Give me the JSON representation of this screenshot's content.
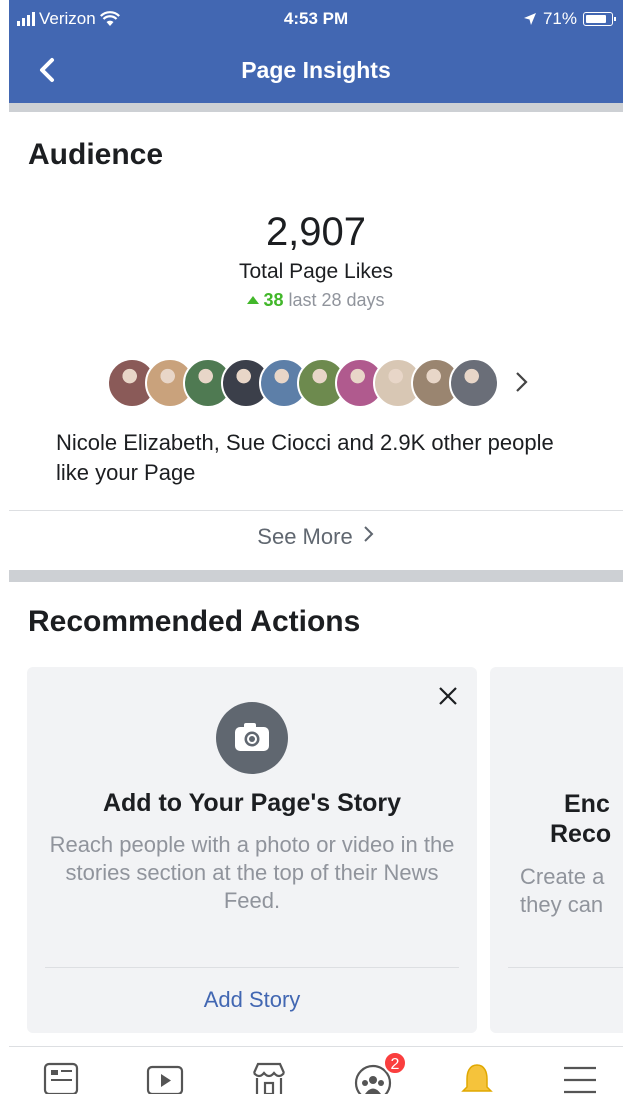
{
  "status_bar": {
    "carrier": "Verizon",
    "time": "4:53 PM",
    "battery": "71%"
  },
  "nav": {
    "title": "Page Insights"
  },
  "audience": {
    "heading": "Audience",
    "total_likes": "2,907",
    "total_likes_label": "Total Page Likes",
    "change_value": "38",
    "change_period": "last 28 days",
    "likers_text": "Nicole Elizabeth, Sue Ciocci and 2.9K other people like your Page",
    "see_more": "See More",
    "avatar_colors": [
      "#8a5a58",
      "#c9a27c",
      "#4f7a52",
      "#3b3f4a",
      "#5d7fa8",
      "#6d8a4e",
      "#b05a8e",
      "#d8c7b4",
      "#9a8570",
      "#6a6e78"
    ]
  },
  "recommended": {
    "heading": "Recommended Actions",
    "card1": {
      "icon": "camera-icon",
      "title": "Add to Your Page's Story",
      "description": "Reach people with a photo or video in the stories section at the top of their News Feed.",
      "action": "Add Story"
    },
    "card2": {
      "title_line1": "Enc",
      "title_line2": "Reco",
      "desc_line1": "Create a",
      "desc_line2": "they can"
    }
  },
  "tabbar": {
    "items": [
      "news-feed-icon",
      "watch-icon",
      "marketplace-icon",
      "groups-icon",
      "notifications-icon",
      "menu-icon"
    ],
    "groups_badge": "2",
    "active_color": "#f5c33b"
  },
  "colors": {
    "brand": "#4267b2",
    "positive": "#42b72a",
    "badge": "#fa3e3e"
  }
}
